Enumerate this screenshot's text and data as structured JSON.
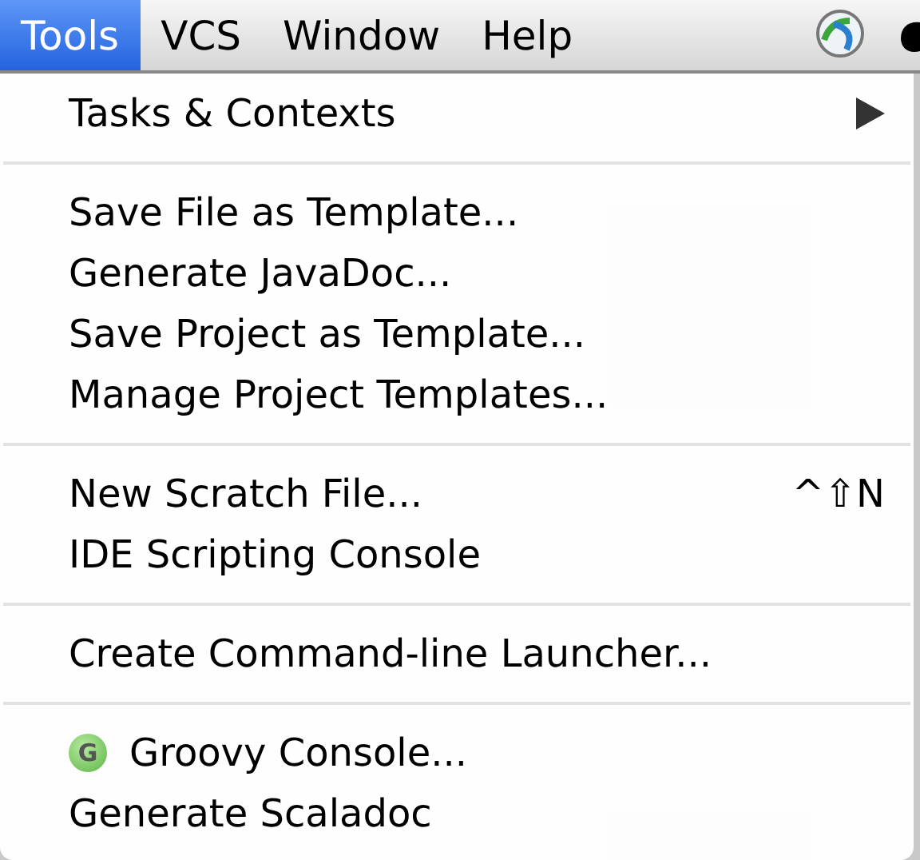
{
  "menubar": [
    {
      "label": "Tools",
      "selected": true
    },
    {
      "label": "VCS",
      "selected": false
    },
    {
      "label": "Window",
      "selected": false
    },
    {
      "label": "Help",
      "selected": false
    }
  ],
  "menu": {
    "groups": [
      [
        {
          "label": "Tasks & Contexts",
          "submenu": true
        }
      ],
      [
        {
          "label": "Save File as Template...",
          "submenu": false
        },
        {
          "label": "Generate JavaDoc...",
          "submenu": false
        },
        {
          "label": "Save Project as Template...",
          "submenu": false
        },
        {
          "label": "Manage Project Templates...",
          "submenu": false
        }
      ],
      [
        {
          "label": "New Scratch File...",
          "submenu": false,
          "shortcut": "^⇧N"
        },
        {
          "label": "IDE Scripting Console",
          "submenu": false
        }
      ],
      [
        {
          "label": "Create Command-line Launcher...",
          "submenu": false
        }
      ],
      [
        {
          "label": "Groovy Console...",
          "submenu": false,
          "icon_letter": "G"
        },
        {
          "label": "Generate Scaladoc",
          "submenu": false
        }
      ]
    ]
  }
}
